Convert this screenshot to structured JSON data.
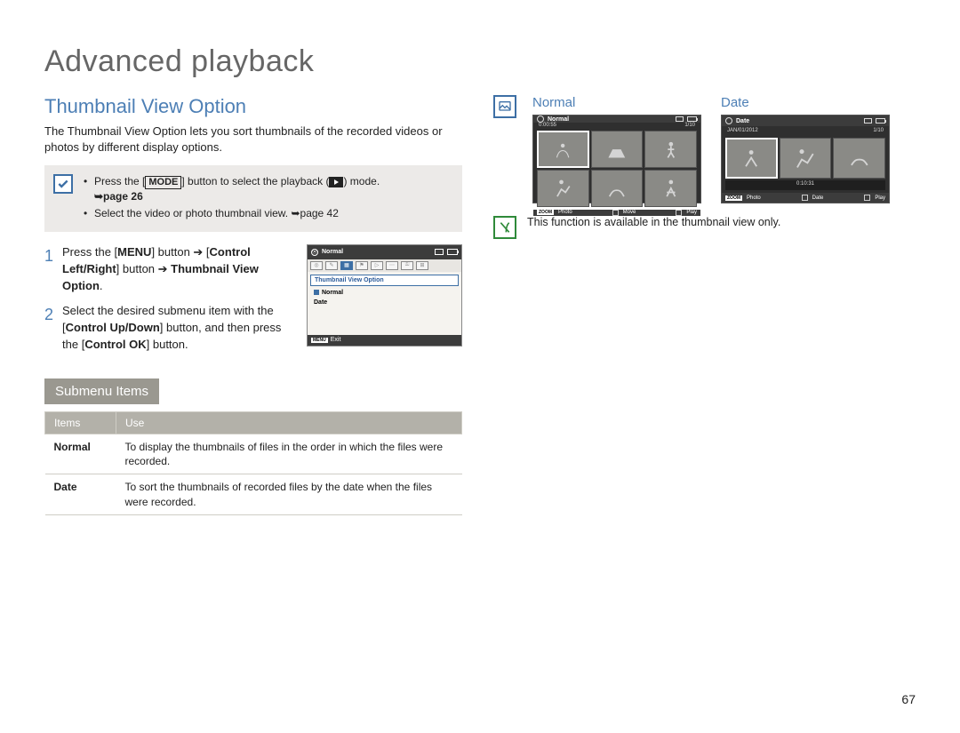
{
  "chapter_title": "Advanced playback",
  "section_title": "Thumbnail View Option",
  "intro": "The Thumbnail View Option lets you sort thumbnails of the recorded videos or photos by different display options.",
  "hint": {
    "line1_a": "Press the [",
    "line1_mode": "MODE",
    "line1_b": "] button to select the playback (",
    "line1_c": ") mode.",
    "line1_page": "➥page 26",
    "line2": "Select the video or photo thumbnail view. ➥page 42"
  },
  "steps": {
    "s1_a": "Press the [",
    "s1_menu": "MENU",
    "s1_b": "] button ➔ [",
    "s1_ctrl": "Control Left/Right",
    "s1_c": "] button ➔ ",
    "s1_opt": "Thumbnail View Option",
    "s1_dot": ".",
    "s2_a": "Select the desired submenu item with the [",
    "s2_ud": "Control Up/Down",
    "s2_b": "] button, and then press the [",
    "s2_ok": "Control OK",
    "s2_c": "] button."
  },
  "lcd_menu": {
    "top_title": "Normal",
    "panel_heading": "Thumbnail View Option",
    "opt_normal": "Normal",
    "opt_date": "Date",
    "exit": "Exit",
    "menu_badge": "MENU"
  },
  "submenu_heading": "Submenu Items",
  "table": {
    "col_items": "Items",
    "col_use": "Use",
    "r1_item": "Normal",
    "r1_use": "To display the thumbnails of files in the order in which the files were recorded.",
    "r2_item": "Date",
    "r2_use": "To sort the thumbnails of recorded files by the date when the files were recorded."
  },
  "previews": {
    "normal_title": "Normal",
    "date_title": "Date",
    "normal_top": "Normal",
    "normal_time": "0:00:55",
    "normal_count": "1/10",
    "date_top": "Date",
    "date_label": "JAN/01/2012",
    "date_count": "1/10",
    "date_dur": "0:10:31",
    "zoom": "ZOOM",
    "photo": "Photo",
    "move": "Move",
    "play": "Play",
    "date_btn": "Date"
  },
  "note_text": "This function is available in the thumbnail view only.",
  "page_number": "67"
}
